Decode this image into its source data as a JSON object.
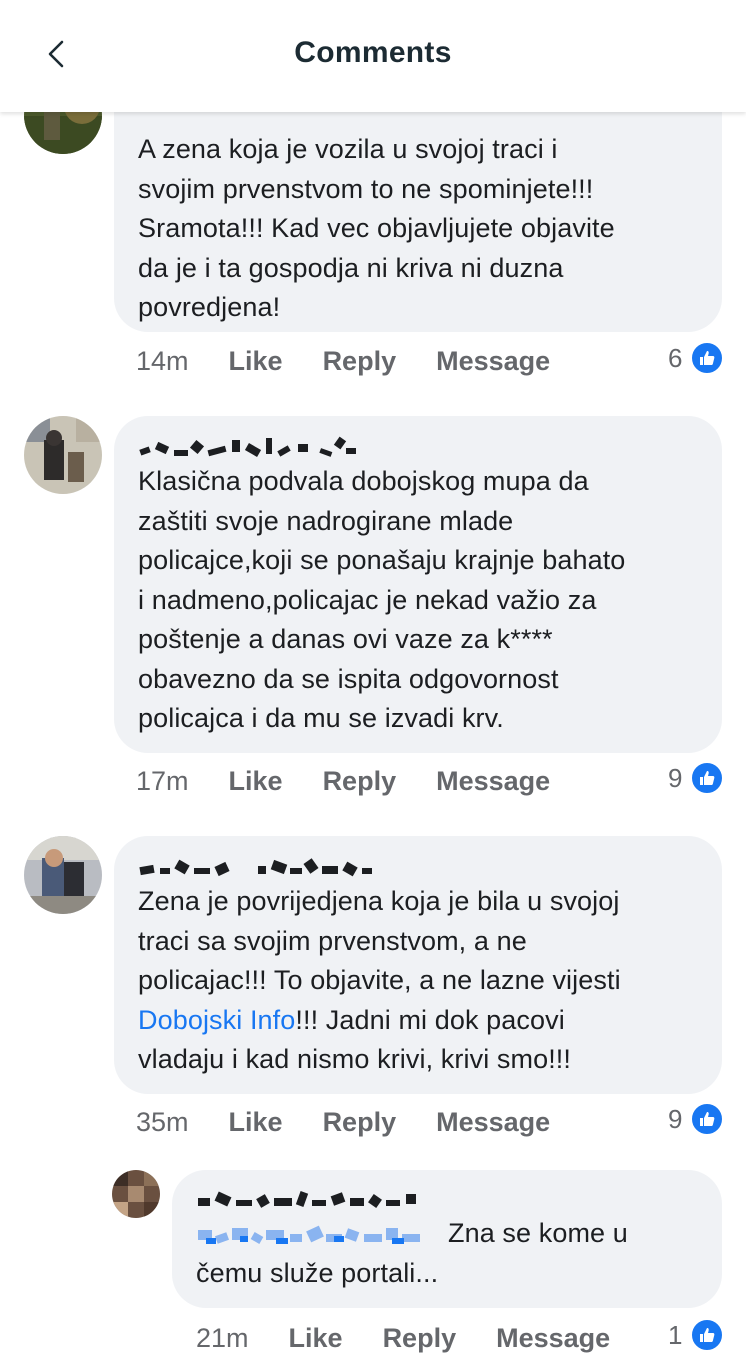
{
  "header": {
    "title": "Comments",
    "back_icon": "chevron-left-icon"
  },
  "colors": {
    "link": "#1877f2",
    "bubble": "#f0f2f5",
    "like_badge": "#1877f2",
    "meta": "#65676b"
  },
  "comments": [
    {
      "text": "A zena koja je vozila u svojoj traci i\nsvojim prvenstvom to ne spominjete!!!\nSramota!!! Kad vec objavljujete objavite\nda je i ta gospodja ni kriva ni duzna\npovredjena!",
      "time": "14m",
      "like": "Like",
      "reply": "Reply",
      "message": "Message",
      "reactions": "6"
    },
    {
      "text": "Klasična podvala dobojskog mupa da\nzaštiti svoje nadrogirane mlade\npolicajce,koji se ponašaju krajnje bahato\ni nadmeno,policajac je nekad važio za\npoštenje a danas ovi vaze za k****\nobavezno da se ispita odgovornost\npolicajca i da mu se izvadi krv.",
      "time": "17m",
      "like": "Like",
      "reply": "Reply",
      "message": "Message",
      "reactions": "9"
    },
    {
      "text_before": "Zena je povrijedjena koja je bila u svojoj\ntraci sa svojim prvenstvom, a ne\npolicajac!!! To objavite, a ne lazne vijesti\n",
      "link": "Dobojski Info",
      "text_after": "!!! Jadni mi dok pacovi\nvladaju i kad nismo krivi, krivi smo!!!",
      "time": "35m",
      "like": "Like",
      "reply": "Reply",
      "message": "Message",
      "reactions": "9"
    },
    {
      "text_line1": "Zna se kome u",
      "text_line2": "čemu služe portali...",
      "time": "21m",
      "like": "Like",
      "reply": "Reply",
      "message": "Message",
      "reactions": "1"
    }
  ]
}
